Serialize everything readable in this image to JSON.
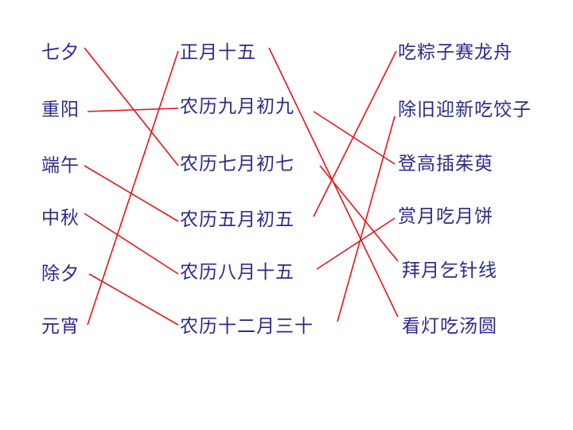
{
  "colors": {
    "text": "#2b2b8a",
    "line": "#e8141a",
    "background": "#ffffff"
  },
  "festivals": [
    "七夕",
    "重阳",
    "端午",
    "中秋",
    "除夕",
    "元宵"
  ],
  "dates": [
    "正月十五",
    "农历九月初九",
    "农历七月初七",
    "农历五月初五",
    "农历八月十五",
    "农历十二月三十"
  ],
  "customs": [
    "吃粽子赛龙舟",
    "除旧迎新吃饺子",
    "登高插茱萸",
    "赏月吃月饼",
    "拜月乞针线",
    "看灯吃汤圆"
  ],
  "connections": {
    "festival_to_date": [
      [
        0,
        2
      ],
      [
        1,
        1
      ],
      [
        2,
        3
      ],
      [
        3,
        4
      ],
      [
        4,
        5
      ],
      [
        5,
        0
      ]
    ],
    "date_to_custom": [
      [
        0,
        5
      ],
      [
        1,
        2
      ],
      [
        2,
        4
      ],
      [
        3,
        0
      ],
      [
        4,
        3
      ],
      [
        5,
        1
      ]
    ]
  }
}
